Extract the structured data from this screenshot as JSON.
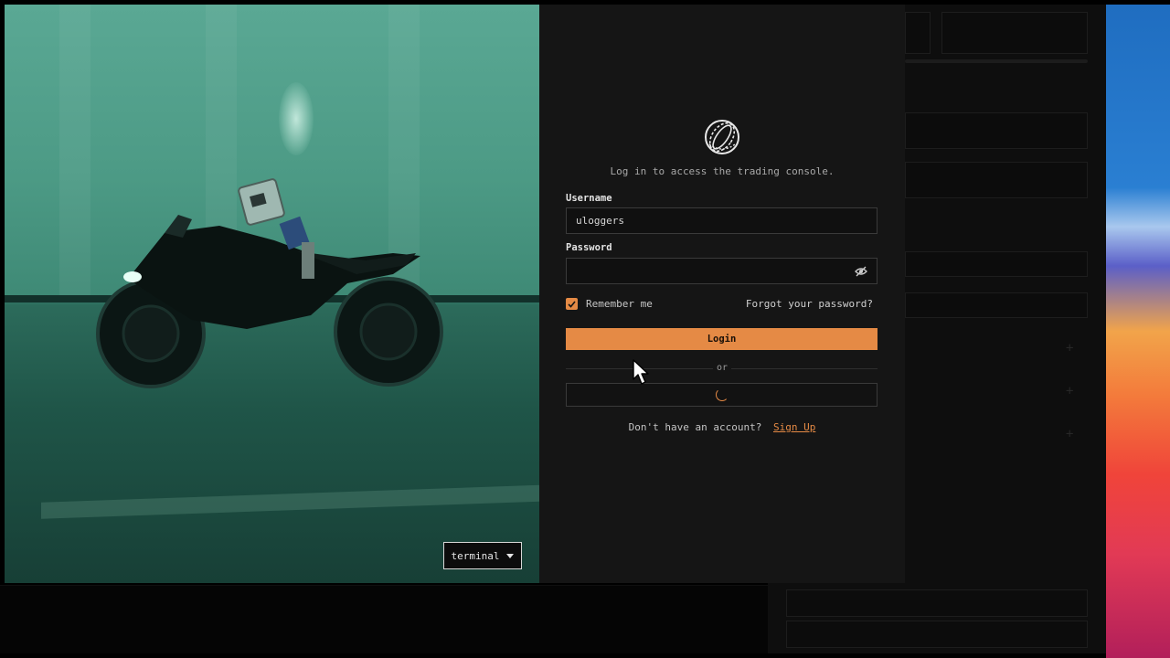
{
  "login": {
    "subtitle": "Log in to access the trading console.",
    "username_label": "Username",
    "username_value": "uloggers",
    "password_label": "Password",
    "password_value": "",
    "remember_label": "Remember me",
    "remember_checked": true,
    "forgot_label": "Forgot your password?",
    "login_button": "Login",
    "divider_text": "or",
    "signup_prompt": "Don't have an account?",
    "signup_link": "Sign Up"
  },
  "hero": {
    "theme_select_value": "terminal"
  },
  "icons": {
    "logo": "brand-logo-icon",
    "password_toggle": "eye-off-icon",
    "remember_check": "checkmark-icon",
    "loading": "spinner-icon",
    "pointer": "mouse-cursor-icon",
    "dropdown": "caret-down-icon"
  },
  "colors": {
    "accent": "#e58a45",
    "panel_bg": "#151515",
    "input_border": "#3a3a3a"
  }
}
